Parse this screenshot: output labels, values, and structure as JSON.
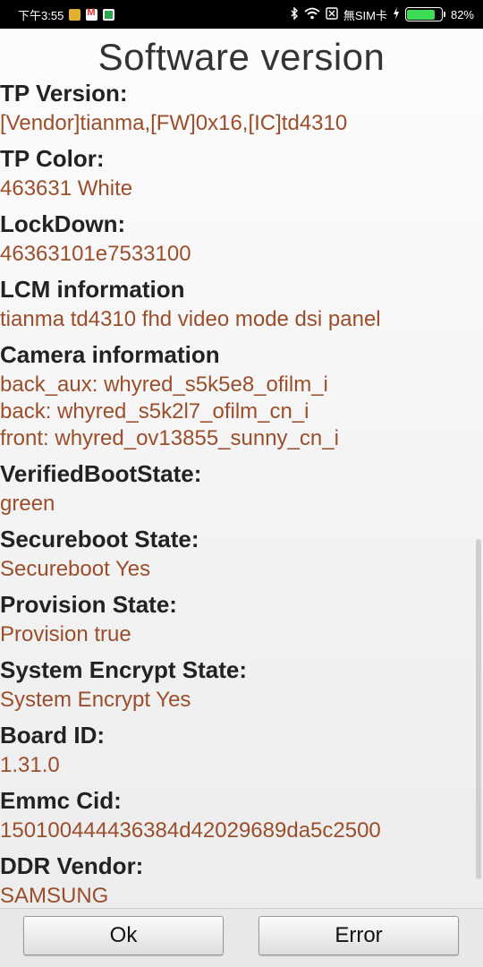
{
  "status_bar": {
    "time": "下午3:55",
    "sim": "無SIM卡",
    "battery": "82%",
    "battery_level": 0.82,
    "icons": [
      "photo-notification-icon",
      "gmail-icon",
      "app-notification-icon",
      "bluetooth-icon",
      "wifi-icon",
      "no-sim-icon",
      "charging-icon",
      "battery-icon"
    ]
  },
  "title": "Software version",
  "sections": [
    {
      "label": "TP Version:",
      "values": [
        "[Vendor]tianma,[FW]0x16,[IC]td4310"
      ]
    },
    {
      "label": "TP Color:",
      "values": [
        "463631 White"
      ]
    },
    {
      "label": "LockDown:",
      "values": [
        "46363101e7533100"
      ]
    },
    {
      "label": "LCM information",
      "values": [
        "tianma td4310 fhd video mode dsi panel"
      ]
    },
    {
      "label": "Camera information",
      "values": [
        "back_aux: whyred_s5k5e8_ofilm_i",
        "back: whyred_s5k2l7_ofilm_cn_i",
        "front: whyred_ov13855_sunny_cn_i"
      ]
    },
    {
      "label": "VerifiedBootState:",
      "values": [
        "green"
      ]
    },
    {
      "label": "Secureboot State:",
      "values": [
        "Secureboot Yes"
      ]
    },
    {
      "label": "Provision State:",
      "values": [
        "Provision true"
      ]
    },
    {
      "label": "System Encrypt State:",
      "values": [
        "System Encrypt  Yes"
      ]
    },
    {
      "label": "Board ID:",
      "values": [
        "1.31.0"
      ]
    },
    {
      "label": "Emmc Cid:",
      "values": [
        "150100444436384d42029689da5c2500"
      ]
    },
    {
      "label": "DDR Vendor:",
      "values": [
        "SAMSUNG"
      ]
    }
  ],
  "buttons": {
    "ok": "Ok",
    "error": "Error"
  },
  "colors": {
    "label": "#222222",
    "value": "#9b4e2b",
    "title": "#333333"
  }
}
